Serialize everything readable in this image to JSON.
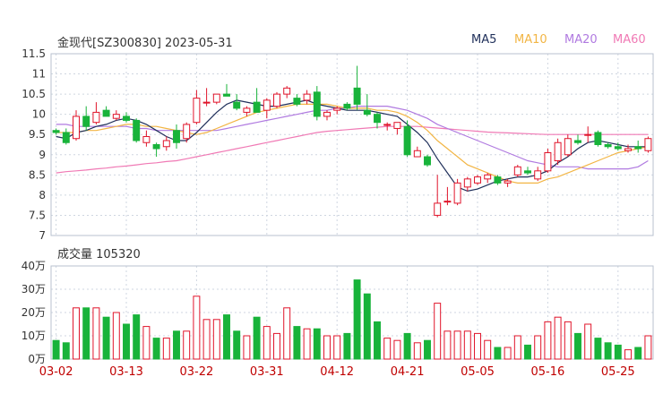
{
  "header": {
    "title": "金现代[SZ300830] 2023-05-31"
  },
  "legend": [
    {
      "name": "MA5",
      "color": "#1f2f5a"
    },
    {
      "name": "MA10",
      "color": "#f2b544"
    },
    {
      "name": "MA20",
      "color": "#b07ae0"
    },
    {
      "name": "MA60",
      "color": "#f07ab5"
    }
  ],
  "volume_panel": {
    "title": "成交量 105320"
  },
  "colors": {
    "up": "#e0142a",
    "down": "#18b33a",
    "grid": "#cfd6e0",
    "axis": "#333333"
  },
  "chart_data": [
    {
      "type": "candlestick",
      "title": "金现代[SZ300830] 2023-05-31",
      "ylim": [
        7,
        11.5
      ],
      "yticks": [
        "11.5",
        "11",
        "10.5",
        "10",
        "9.5",
        "9",
        "8.5",
        "8",
        "7.5",
        "7"
      ],
      "xticks": [
        {
          "label": "03-02",
          "index": 0
        },
        {
          "label": "03-13",
          "index": 7
        },
        {
          "label": "03-22",
          "index": 14
        },
        {
          "label": "03-31",
          "index": 21
        },
        {
          "label": "04-12",
          "index": 28
        },
        {
          "label": "04-21",
          "index": 35
        },
        {
          "label": "05-05",
          "index": 42
        },
        {
          "label": "05-16",
          "index": 49
        },
        {
          "label": "05-25",
          "index": 56
        }
      ],
      "ohlc": [
        [
          9.6,
          9.65,
          9.5,
          9.55
        ],
        [
          9.55,
          9.65,
          9.25,
          9.3
        ],
        [
          9.4,
          10.1,
          9.35,
          9.95
        ],
        [
          9.95,
          10.2,
          9.6,
          9.7
        ],
        [
          9.8,
          10.3,
          9.75,
          10.05
        ],
        [
          10.1,
          10.2,
          9.95,
          9.95
        ],
        [
          9.9,
          10.1,
          9.85,
          10.0
        ],
        [
          9.95,
          10.05,
          9.8,
          9.85
        ],
        [
          9.85,
          9.9,
          9.3,
          9.35
        ],
        [
          9.3,
          9.6,
          9.2,
          9.45
        ],
        [
          9.25,
          9.3,
          8.95,
          9.15
        ],
        [
          9.2,
          9.45,
          9.1,
          9.35
        ],
        [
          9.6,
          9.75,
          9.15,
          9.3
        ],
        [
          9.4,
          9.8,
          9.3,
          9.75
        ],
        [
          9.8,
          10.6,
          9.75,
          10.4
        ],
        [
          10.3,
          10.65,
          10.2,
          10.3
        ],
        [
          10.3,
          10.5,
          10.25,
          10.5
        ],
        [
          10.5,
          10.75,
          10.45,
          10.45
        ],
        [
          10.3,
          10.5,
          10.1,
          10.15
        ],
        [
          10.05,
          10.2,
          9.95,
          10.15
        ],
        [
          10.3,
          10.65,
          10.2,
          10.05
        ],
        [
          10.1,
          10.4,
          9.9,
          10.35
        ],
        [
          10.2,
          10.55,
          10.15,
          10.5
        ],
        [
          10.5,
          10.7,
          10.4,
          10.65
        ],
        [
          10.4,
          10.5,
          10.2,
          10.25
        ],
        [
          10.35,
          10.6,
          10.25,
          10.5
        ],
        [
          10.55,
          10.7,
          9.85,
          9.95
        ],
        [
          9.95,
          10.1,
          9.85,
          10.05
        ],
        [
          10.1,
          10.2,
          10.0,
          10.15
        ],
        [
          10.25,
          10.3,
          10.1,
          10.15
        ],
        [
          10.65,
          11.2,
          10.1,
          10.25
        ],
        [
          10.1,
          10.5,
          9.95,
          10.0
        ],
        [
          10.0,
          10.05,
          9.65,
          9.8
        ],
        [
          9.75,
          9.8,
          9.6,
          9.75
        ],
        [
          9.65,
          9.8,
          9.5,
          9.8
        ],
        [
          9.7,
          9.85,
          8.95,
          9.0
        ],
        [
          8.95,
          9.2,
          8.95,
          9.1
        ],
        [
          8.95,
          9.0,
          8.7,
          8.75
        ],
        [
          7.5,
          8.5,
          7.45,
          7.8
        ],
        [
          7.85,
          8.2,
          7.75,
          7.85
        ],
        [
          7.8,
          8.4,
          7.75,
          8.3
        ],
        [
          8.2,
          8.45,
          8.1,
          8.4
        ],
        [
          8.3,
          8.5,
          8.25,
          8.45
        ],
        [
          8.4,
          8.55,
          8.3,
          8.5
        ],
        [
          8.45,
          8.5,
          8.25,
          8.3
        ],
        [
          8.3,
          8.4,
          8.2,
          8.35
        ],
        [
          8.5,
          8.75,
          8.45,
          8.7
        ],
        [
          8.6,
          8.7,
          8.5,
          8.55
        ],
        [
          8.4,
          8.7,
          8.35,
          8.6
        ],
        [
          8.6,
          9.15,
          8.55,
          9.05
        ],
        [
          8.85,
          9.4,
          8.75,
          9.3
        ],
        [
          9.0,
          9.5,
          8.95,
          9.4
        ],
        [
          9.35,
          9.5,
          9.25,
          9.3
        ],
        [
          9.5,
          9.7,
          9.3,
          9.5
        ],
        [
          9.55,
          9.6,
          9.2,
          9.25
        ],
        [
          9.25,
          9.3,
          9.15,
          9.2
        ],
        [
          9.2,
          9.3,
          9.1,
          9.15
        ],
        [
          9.1,
          9.25,
          9.05,
          9.15
        ],
        [
          9.2,
          9.35,
          9.05,
          9.15
        ],
        [
          9.1,
          9.45,
          9.05,
          9.4
        ]
      ],
      "ma": {
        "MA5": [
          9.45,
          9.4,
          9.55,
          9.6,
          9.7,
          9.75,
          9.85,
          9.9,
          9.85,
          9.75,
          9.6,
          9.45,
          9.35,
          9.35,
          9.55,
          9.8,
          10.05,
          10.25,
          10.35,
          10.3,
          10.25,
          10.2,
          10.2,
          10.25,
          10.3,
          10.35,
          10.25,
          10.2,
          10.15,
          10.1,
          10.1,
          10.1,
          10.05,
          10.0,
          9.95,
          9.75,
          9.55,
          9.3,
          8.9,
          8.55,
          8.2,
          8.1,
          8.15,
          8.25,
          8.35,
          8.4,
          8.45,
          8.45,
          8.5,
          8.6,
          8.8,
          8.95,
          9.15,
          9.3,
          9.35,
          9.3,
          9.25,
          9.2,
          9.2,
          9.2
        ],
        "MA10": [
          9.55,
          9.55,
          9.55,
          9.6,
          9.6,
          9.65,
          9.7,
          9.75,
          9.75,
          9.7,
          9.7,
          9.65,
          9.6,
          9.55,
          9.5,
          9.55,
          9.65,
          9.75,
          9.85,
          9.95,
          10.05,
          10.1,
          10.15,
          10.2,
          10.25,
          10.25,
          10.25,
          10.25,
          10.2,
          10.15,
          10.15,
          10.15,
          10.1,
          10.1,
          10.05,
          9.95,
          9.8,
          9.6,
          9.35,
          9.15,
          8.95,
          8.75,
          8.65,
          8.55,
          8.45,
          8.35,
          8.3,
          8.3,
          8.3,
          8.4,
          8.45,
          8.55,
          8.65,
          8.75,
          8.85,
          8.95,
          9.05,
          9.1,
          9.15,
          9.2
        ],
        "MA20": [
          9.75,
          9.75,
          9.7,
          9.7,
          9.7,
          9.7,
          9.7,
          9.7,
          9.65,
          9.65,
          9.6,
          9.6,
          9.6,
          9.6,
          9.6,
          9.6,
          9.6,
          9.65,
          9.7,
          9.75,
          9.8,
          9.85,
          9.9,
          9.95,
          10.0,
          10.05,
          10.1,
          10.1,
          10.15,
          10.15,
          10.2,
          10.2,
          10.2,
          10.2,
          10.15,
          10.1,
          10.0,
          9.9,
          9.75,
          9.65,
          9.55,
          9.45,
          9.35,
          9.25,
          9.15,
          9.05,
          8.95,
          8.85,
          8.8,
          8.75,
          8.7,
          8.7,
          8.7,
          8.65,
          8.65,
          8.65,
          8.65,
          8.65,
          8.7,
          8.85
        ],
        "MA60": [
          8.55,
          8.58,
          8.6,
          8.62,
          8.65,
          8.67,
          8.7,
          8.72,
          8.75,
          8.78,
          8.8,
          8.83,
          8.85,
          8.9,
          8.95,
          9.0,
          9.05,
          9.1,
          9.15,
          9.2,
          9.25,
          9.3,
          9.35,
          9.4,
          9.45,
          9.5,
          9.55,
          9.58,
          9.6,
          9.62,
          9.64,
          9.66,
          9.68,
          9.7,
          9.7,
          9.7,
          9.7,
          9.68,
          9.66,
          9.64,
          9.62,
          9.6,
          9.58,
          9.56,
          9.55,
          9.54,
          9.53,
          9.52,
          9.51,
          9.5,
          9.5,
          9.5,
          9.5,
          9.5,
          9.5,
          9.5,
          9.5,
          9.5,
          9.5,
          9.5
        ]
      }
    },
    {
      "type": "bar",
      "title": "成交量 105320",
      "ylim": [
        0,
        40
      ],
      "yticks": [
        "40万",
        "30万",
        "20万",
        "10万",
        "0万"
      ],
      "values": [
        8,
        7,
        22,
        22,
        22,
        18,
        20,
        15,
        19,
        14,
        9,
        9,
        12,
        12,
        27,
        17,
        17,
        19,
        12,
        10,
        18,
        14,
        11,
        22,
        14,
        13,
        13,
        10,
        10,
        11,
        34,
        28,
        16,
        9,
        8,
        11,
        7,
        8,
        24,
        12,
        12,
        12,
        11,
        8,
        5,
        5,
        10,
        6,
        10,
        16,
        18,
        16,
        11,
        15,
        9,
        7,
        6,
        4,
        5,
        10
      ]
    }
  ]
}
